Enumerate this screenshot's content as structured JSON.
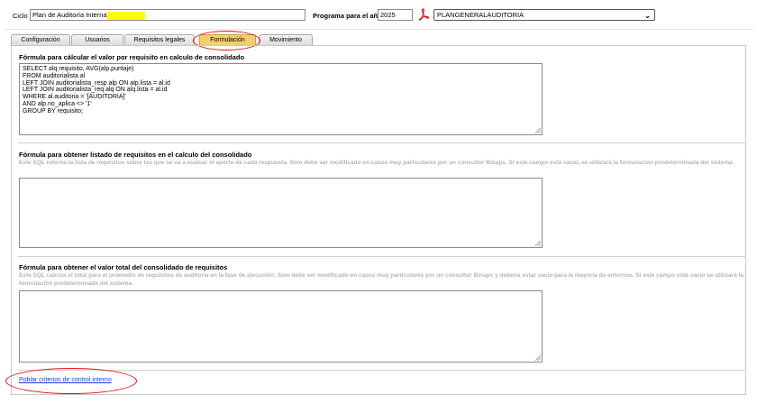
{
  "header": {
    "ciclo_label": "Ciclo",
    "ciclo_value": "Plan de Auditoría Interna",
    "programa_label": "Programa para el año",
    "programa_year": "2025",
    "pdf_icon": "pdf-icon",
    "plan_select_value": "PLANGENERALAUDITORIA"
  },
  "tabs": [
    {
      "label": "Configuración"
    },
    {
      "label": "Usuarios"
    },
    {
      "label": "Requisitos legales"
    },
    {
      "label": "Formulación"
    },
    {
      "label": "Movimiento"
    }
  ],
  "sections": {
    "s1": {
      "title": "Fórmula para cálcular el valor por requisito en calculo de consolidado",
      "sql": "SELECT alq.requisito, AVG(alp.puntaje)\nFROM auditorialista al\nLEFT JOIN auditorialista_resp alp ON alp.lista = al.id\nLEFT JOIN auditorialista_req alq ON alq.lista = al.id\nWHERE al.auditoria = '[AUDITORIA]'\nAND alp.no_aplica <> '1'\nGROUP BY requisito;"
    },
    "s2": {
      "title": "Fórmula para obtener listado de requisitos en el calculo del consolidado",
      "desc": "Este SQL retorna la lista de requisitos sobre los que se va a evaluar el aporte de cada respuesta. Solo debe ser modificado en casos muy particulares por un consultor Binaps. Si este campo está vacio, se utilizará la formulacion predeterminada del sistema.",
      "sql": ""
    },
    "s3": {
      "title": "Fórmula para obtener el valor total del consolidado de requisitos",
      "desc": "Este SQL calcula el total para el promedio de requisitos de auditoria en la fase de ejecución. Solo debe ser modificado en casos muy particulares por un consultor Binaps y deberia estar vacio para la mayoria de entornos. Si este campo está vacio se utilizará la formulación predeterminada del sistema.",
      "sql": ""
    }
  },
  "footer": {
    "link_label": "Poblar criterios de control interno"
  },
  "colors": {
    "accent_tab": "#f3d06d",
    "annotation": "#e01010",
    "link": "#1a3fd0",
    "highlight": "#ffff00"
  }
}
